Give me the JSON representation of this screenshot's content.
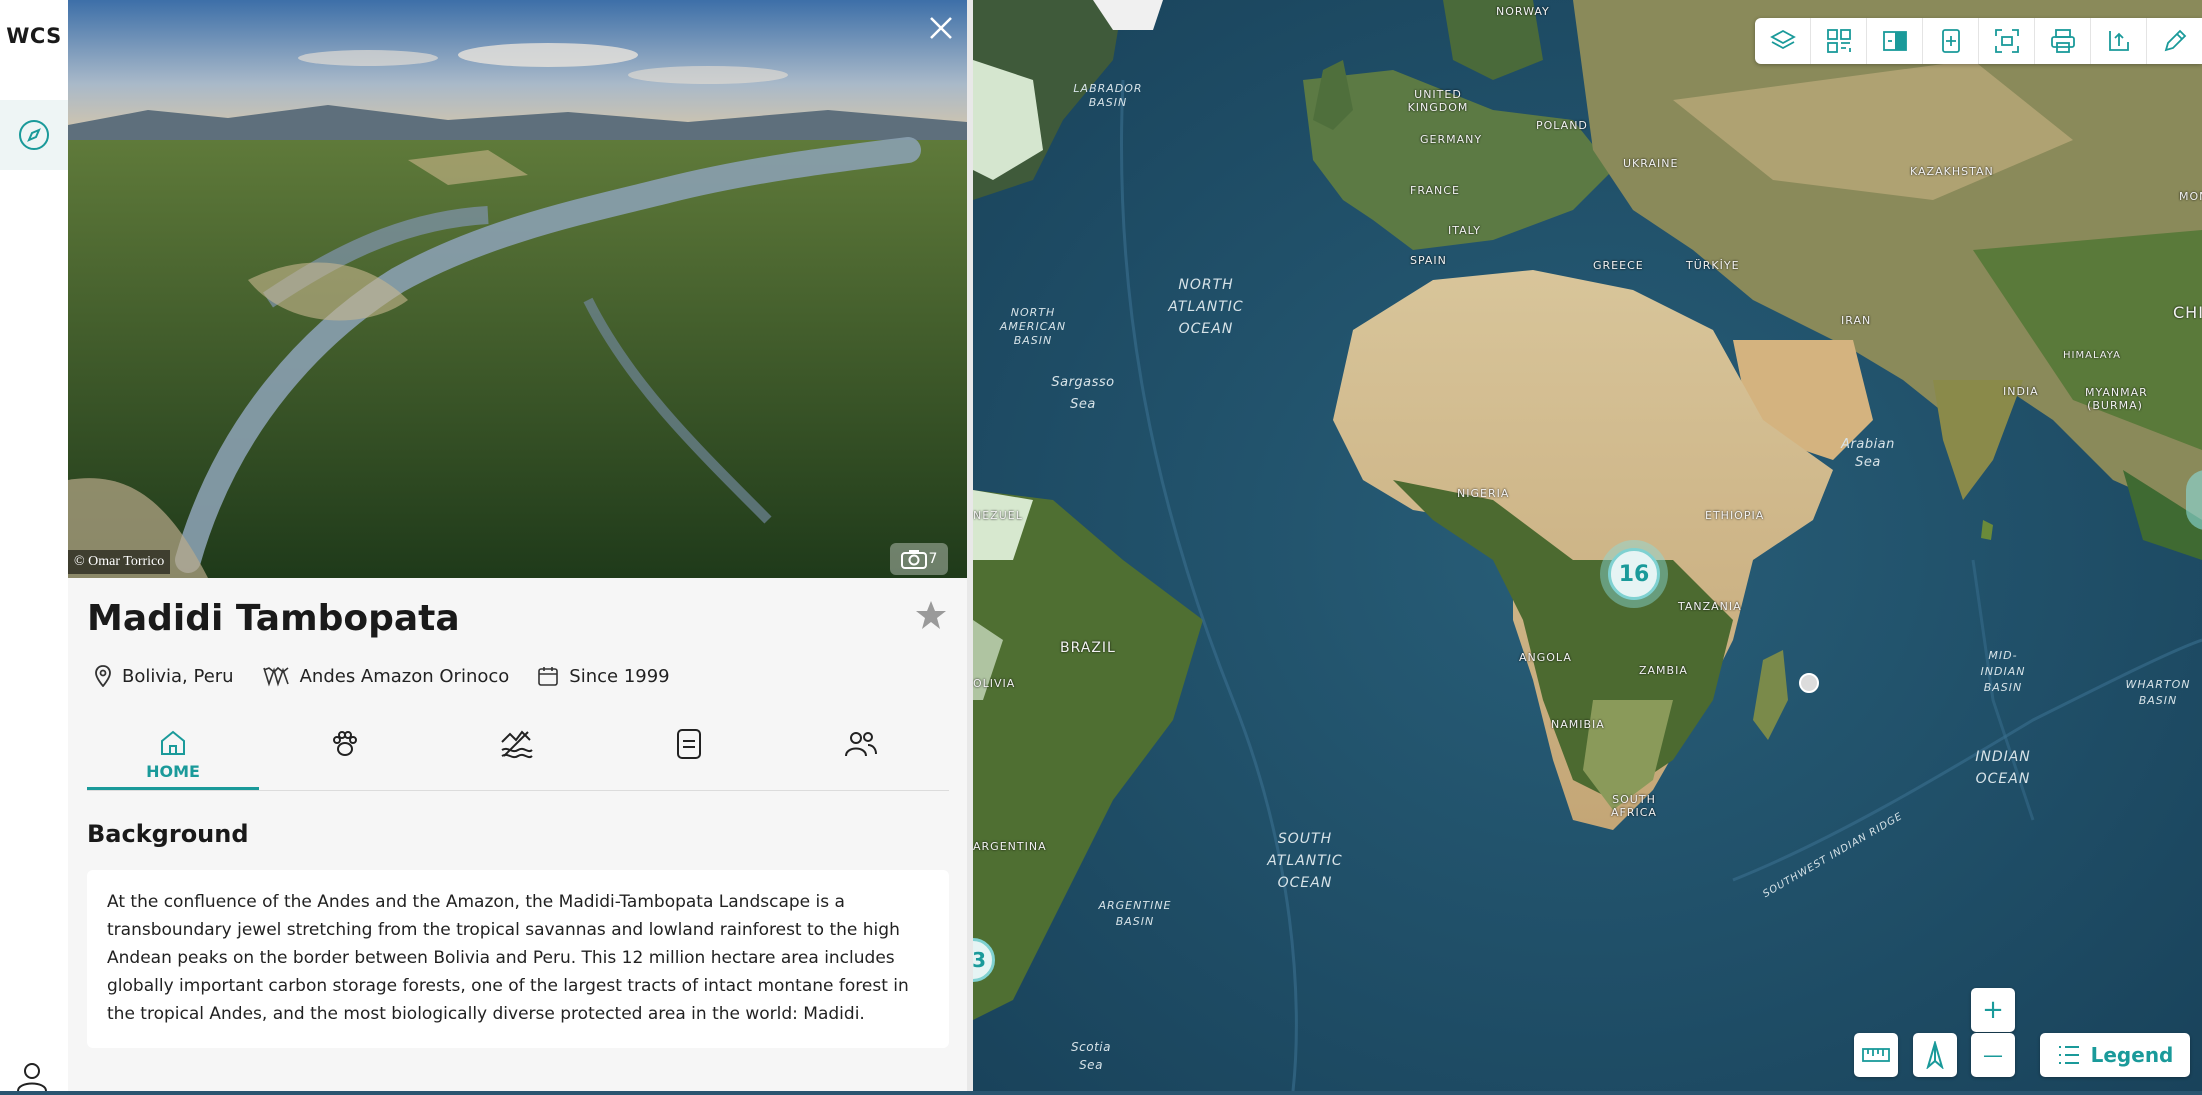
{
  "app": {
    "logo": "WCS"
  },
  "rail": {
    "items": [
      {
        "icon": "compass-icon"
      },
      {
        "icon": "user-icon"
      }
    ]
  },
  "panel": {
    "photo_credit": "© Omar Torrico",
    "photo_count": "7",
    "title": "Madidi Tambopata",
    "meta": {
      "location": "Bolivia, Peru",
      "region": "Andes Amazon Orinoco",
      "since": "Since 1999"
    },
    "tabs": [
      {
        "label": "HOME",
        "icon": "home-icon",
        "active": true
      },
      {
        "label": "",
        "icon": "paw-icon",
        "active": false
      },
      {
        "label": "",
        "icon": "landscape-icon",
        "active": false
      },
      {
        "label": "",
        "icon": "document-icon",
        "active": false
      },
      {
        "label": "",
        "icon": "people-icon",
        "active": false
      }
    ],
    "background_title": "Background",
    "background_text": "At the confluence of the Andes and the Amazon, the Madidi-Tambopata Landscape is a transboundary jewel stretching from the tropical savannas and lowland rainforest to the high Andean peaks on the border between Bolivia and Peru. This 12 million hectare area includes globally important carbon storage forests, one of the largest tracts of intact montane forest in the tropical Andes, and the most biologically diverse protected area in the world: Madidi."
  },
  "map": {
    "ocean_labels": {
      "north_atlantic": "NORTH\nATLANTIC\nOCEAN",
      "south_atlantic": "SOUTH\nATLANTIC\nOCEAN",
      "indian": "INDIAN\nOCEAN",
      "labrador": "LABRADOR\nBASIN",
      "na_basin": "NORTH\nAMERICAN\nBASIN",
      "sargasso": "Sargasso\nSea",
      "arabian": "Arabian\nSea",
      "argentine": "ARGENTINE\nBASIN",
      "scotia": "Scotia\nSea",
      "mid_indian": "MID-\nINDIAN\nBASIN",
      "wharton": "WHARTON\nBASIN",
      "sw_ridge": "SOUTHWEST INDIAN RIDGE"
    },
    "country_labels": [
      "NORWAY",
      "UNITED KINGDOM",
      "GERMANY",
      "POLAND",
      "UKRAINE",
      "KAZAKHSTAN",
      "MONGO",
      "FRANCE",
      "ITALY",
      "SPAIN",
      "GREECE",
      "TÜRKİYE",
      "CHIN",
      "IRAN",
      "HIMALAYA",
      "INDIA",
      "MYANMAR (BURMA)",
      "NIGERIA",
      "ETHIOPIA",
      "TANZANIA",
      "ANGOLA",
      "ZAMBIA",
      "NAMIBIA",
      "SOUTH AFRICA",
      "BRAZIL",
      "OLIVIA",
      "ARGENTINA",
      "NEZUEL"
    ],
    "cluster_main": "16",
    "cluster_edge": "3",
    "toolbar": [
      "layers-icon",
      "qr-icon",
      "compare-icon",
      "report-icon",
      "fullscreen-icon",
      "print-icon",
      "upload-icon",
      "draw-icon"
    ],
    "zoom_in": "+",
    "zoom_out": "—",
    "legend_label": "Legend"
  },
  "colors": {
    "accent": "#1a9a9a",
    "ocean": "#1f4d66",
    "panel_bg": "#f6f6f6"
  }
}
